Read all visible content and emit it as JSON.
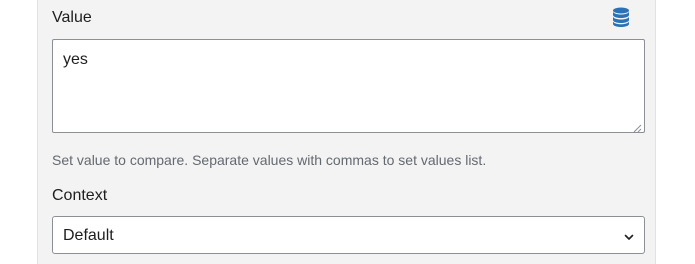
{
  "value_field": {
    "label": "Value",
    "value": "yes",
    "help_text": "Set value to compare. Separate values with commas to set values list.",
    "icon": "database-icon",
    "icon_color": "#2a72b5"
  },
  "context_field": {
    "label": "Context",
    "selected": "Default",
    "icon": "chevron-down-icon"
  },
  "colors": {
    "panel_bg": "#f3f3f3",
    "border": "#8c8f94",
    "text": "#1e1e1e",
    "help_text": "#646970"
  }
}
